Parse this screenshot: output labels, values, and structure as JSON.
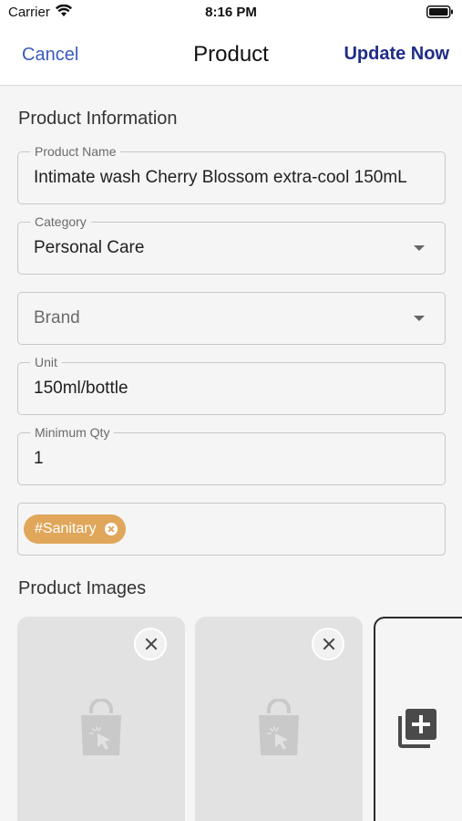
{
  "status_bar": {
    "carrier": "Carrier",
    "time": "8:16 PM"
  },
  "nav": {
    "cancel_label": "Cancel",
    "title": "Product",
    "update_label": "Update Now"
  },
  "product_information": {
    "section_title": "Product Information",
    "product_name": {
      "label": "Product Name",
      "value": "Intimate wash Cherry Blossom extra-cool 150mL"
    },
    "category": {
      "label": "Category",
      "value": "Personal Care"
    },
    "brand": {
      "placeholder": "Brand"
    },
    "unit": {
      "label": "Unit",
      "value": "150ml/bottle"
    },
    "minimum_qty": {
      "label": "Minimum Qty",
      "value": "1"
    },
    "tags": [
      "#Sanitary"
    ]
  },
  "product_images": {
    "section_title": "Product Images",
    "image_count": 2
  },
  "colors": {
    "accent": "#3a5bc0",
    "update_button": "#1f2d86",
    "tag_chip": "#e0a65a",
    "image_placeholder": "#e2e2e2"
  },
  "icons": [
    "wifi-icon",
    "battery-icon",
    "dropdown-arrow-icon",
    "chip-remove-icon",
    "close-icon",
    "shopping-bag-icon",
    "add-photo-icon"
  ]
}
